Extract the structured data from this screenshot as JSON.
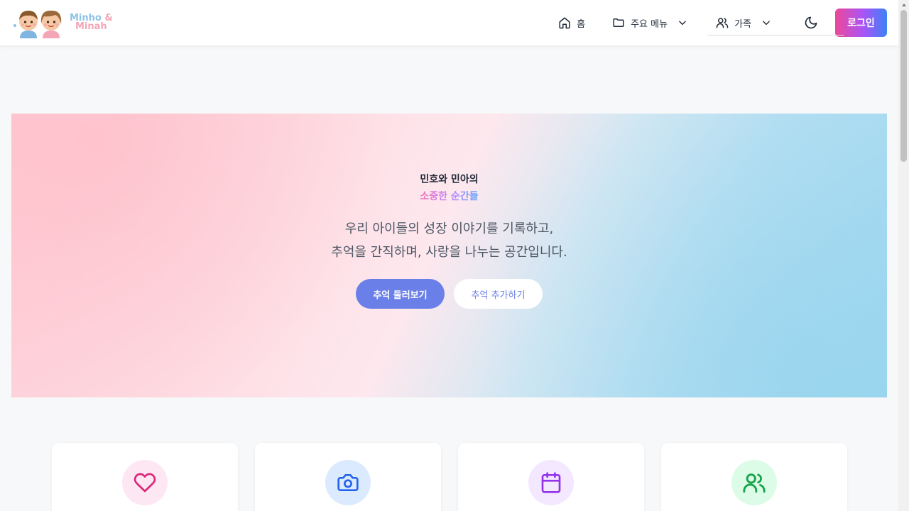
{
  "header": {
    "logo": {
      "line1": "Minho",
      "amp": "&",
      "line2": "Minah",
      "icon": "kids-logo-icon"
    },
    "nav": {
      "home": {
        "label": "홈",
        "icon": "home-icon"
      },
      "menu": {
        "label": "주요 메뉴",
        "icon": "folder-icon"
      },
      "family": {
        "label": "가족",
        "icon": "users-icon"
      },
      "theme_icon": "moon-icon",
      "login_label": "로그인"
    }
  },
  "hero": {
    "title": "민호와 민아의",
    "subtitle": "소중한 순간들",
    "description_line1": "우리 아이들의 성장 이야기를 기록하고,",
    "description_line2": "추억을 간직하며, 사랑을 나누는 공간입니다.",
    "primary_button": "추억 둘러보기",
    "secondary_button": "추억 추가하기"
  },
  "features": [
    {
      "icon": "heart-icon",
      "bg": "#fce7f3",
      "color": "#db2777"
    },
    {
      "icon": "camera-icon",
      "bg": "#dbeafe",
      "color": "#2563eb"
    },
    {
      "icon": "calendar-icon",
      "bg": "#f3e8ff",
      "color": "#9333ea"
    },
    {
      "icon": "users-icon",
      "bg": "#dcfce7",
      "color": "#16a34a"
    }
  ],
  "colors": {
    "accent": "#6b7fe8",
    "login_gradient": [
      "#ec4899",
      "#a855f7",
      "#3b82f6"
    ]
  }
}
